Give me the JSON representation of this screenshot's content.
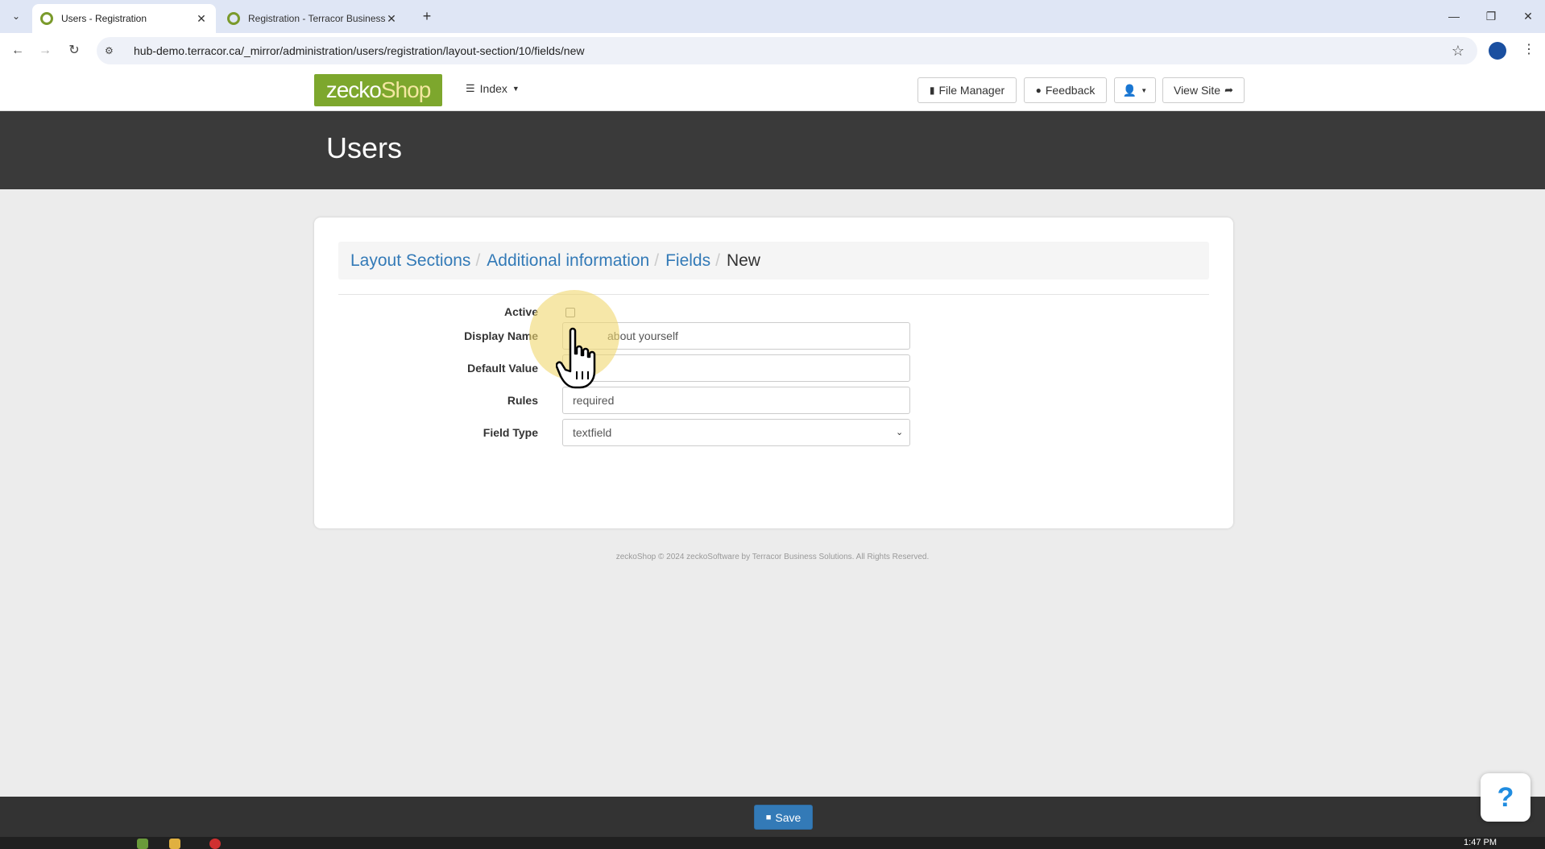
{
  "browser": {
    "tabs": [
      {
        "title": "Users - Registration",
        "active": true
      },
      {
        "title": "Registration - Terracor Business",
        "active": false
      }
    ],
    "url": "hub-demo.terracor.ca/_mirror/administration/users/registration/layout-section/10/fields/new"
  },
  "header": {
    "logo_main": "zecko",
    "logo_accent": "Shop",
    "index_label": "Index",
    "buttons": {
      "file_manager": "File Manager",
      "feedback": "Feedback",
      "view_site": "View Site"
    }
  },
  "page": {
    "title": "Users"
  },
  "breadcrumb": [
    {
      "label": "Layout Sections"
    },
    {
      "label": "Additional information"
    },
    {
      "label": "Fields"
    },
    {
      "label": "New"
    }
  ],
  "form": {
    "active": {
      "label": "Active",
      "checked": false
    },
    "display_name": {
      "label": "Display Name",
      "value": "about yourself"
    },
    "default_value": {
      "label": "Default Value",
      "value": ""
    },
    "rules": {
      "label": "Rules",
      "value": "required"
    },
    "field_type": {
      "label": "Field Type",
      "value": "textfield"
    }
  },
  "footer": {
    "copyright": "zeckoShop © 2024 zeckoSoftware by Terracor Business Solutions. All Rights Reserved."
  },
  "actions": {
    "save_label": "Save",
    "help_label": "?"
  },
  "taskbar": {
    "clock": "1:47 PM"
  },
  "colors": {
    "accent": "#337ab7",
    "logo_green": "#7da72d",
    "hero_bg": "#3a3a3a"
  }
}
